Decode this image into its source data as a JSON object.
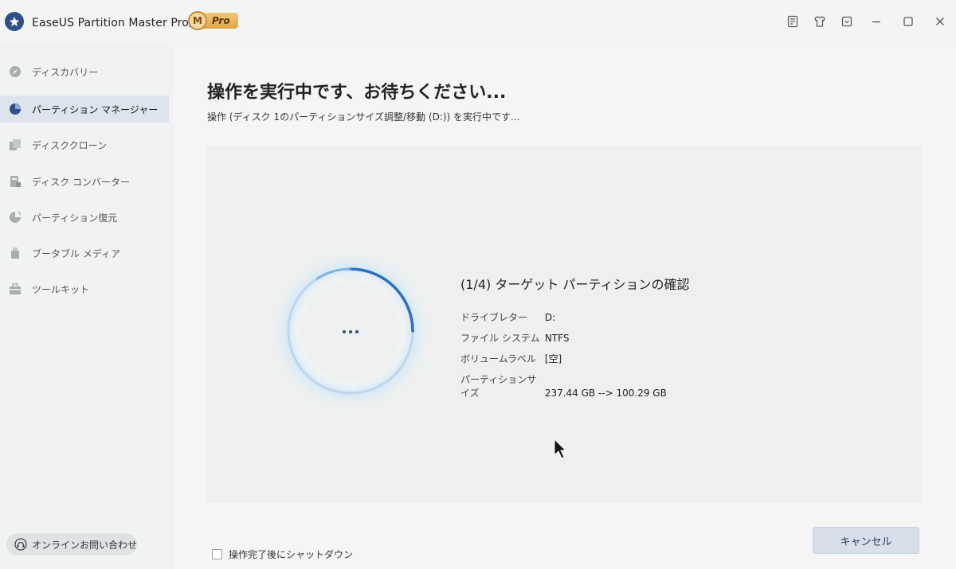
{
  "app": {
    "title": "EaseUS Partition Master Pro版",
    "badge_m": "M",
    "badge_pro": "Pro"
  },
  "titlebar_icons": [
    "feedback-icon",
    "skin-icon",
    "menu-icon",
    "minimize-icon",
    "maximize-icon",
    "close-icon"
  ],
  "sidebar": {
    "items": [
      {
        "label": "ディスカバリー",
        "icon": "compass-icon",
        "active": false
      },
      {
        "label": "パーティション マネージャー",
        "icon": "pie-chart-icon",
        "active": true
      },
      {
        "label": "ディスククローン",
        "icon": "clone-icon",
        "active": false
      },
      {
        "label": "ディスク コンバーター",
        "icon": "converter-icon",
        "active": false
      },
      {
        "label": "パーティション復元",
        "icon": "recovery-icon",
        "active": false
      },
      {
        "label": "ブータブル メディア",
        "icon": "usb-icon",
        "active": false
      },
      {
        "label": "ツールキット",
        "icon": "toolkit-icon",
        "active": false
      }
    ],
    "support_label": "オンラインお問い合わせ"
  },
  "main": {
    "headline": "操作を実行中です、お待ちください...",
    "subline": "操作 (ディスク 1のパーティションサイズ調整/移動 (D:)) を実行中です...",
    "loading_indicator": "...",
    "step": {
      "title": "(1/4) ターゲット パーティションの確認",
      "details": [
        {
          "key": "ドライブレター",
          "value": "D:"
        },
        {
          "key": "ファイル システム",
          "value": "NTFS"
        },
        {
          "key": "ボリュームラベル",
          "value": "[空]"
        },
        {
          "key": "パーティションサイズ",
          "value": "237.44 GB --> 100.29 GB"
        }
      ]
    },
    "shutdown_label": "操作完了後にシャットダウン",
    "shutdown_checked": false,
    "cancel_label": "キャンセル"
  },
  "colors": {
    "accent": "#2f4f8a",
    "spinner": "#2a6fc4",
    "active_bg": "#dde4ee"
  }
}
